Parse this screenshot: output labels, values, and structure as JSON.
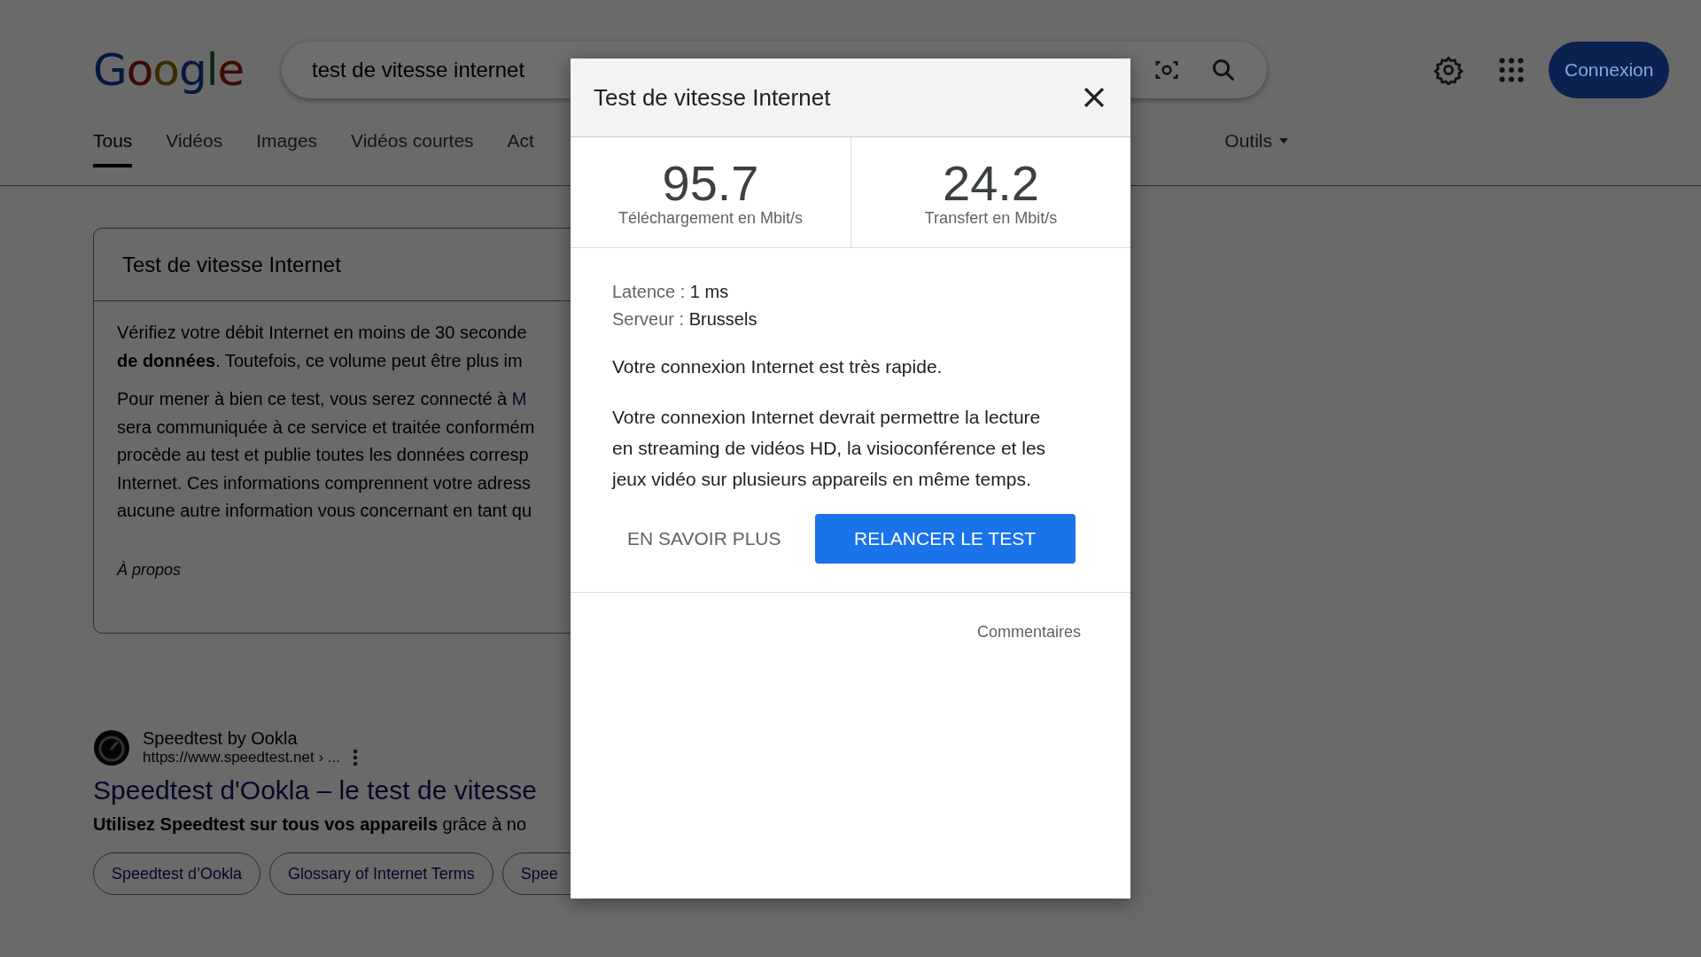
{
  "logo": "Google",
  "search": {
    "value": "test de vitesse internet"
  },
  "account_button": "Connexion",
  "tabs": [
    {
      "label": "Tous",
      "selected": true
    },
    {
      "label": "Vidéos",
      "selected": false
    },
    {
      "label": "Images",
      "selected": false
    },
    {
      "label": "Vidéos courtes",
      "selected": false
    },
    {
      "label": "Act",
      "selected": false
    }
  ],
  "tools": "Outils",
  "card": {
    "title": "Test de vitesse Internet",
    "paragraphs": [
      {
        "lines": [
          {
            "text": "Vérifiez votre débit Internet en moins de 30 seconde"
          },
          {
            "text": "**de données**. Toutefois, ce volume peut être plus im"
          }
        ]
      },
      {
        "lines": [
          {
            "text": "Pour mener à bien ce test, vous serez connecté à ",
            "link": "M"
          },
          {
            "text": "sera communiquée à ce service et traitée conformém"
          },
          {
            "text": "procède au test et publie toutes les données corresp"
          },
          {
            "text": "Internet. Ces informations comprennent votre adress"
          },
          {
            "text": "aucune autre information vous concernant en tant qu"
          }
        ]
      }
    ],
    "about": "À propos"
  },
  "result": {
    "site": "Speedtest by Ookla",
    "url": "https://www.speedtest.net › ...",
    "title": "Speedtest d'Ookla – le test de vitesse",
    "snippet": "**Utilisez Speedtest sur tous vos appareils** grâce à no",
    "chips": [
      "Speedtest d’Ookla",
      "Glossary of Internet Terms",
      "Spee"
    ]
  },
  "dialog": {
    "title": "Test de vitesse Internet",
    "stats": [
      {
        "value": "95.7",
        "label": "Téléchargement en Mbit/s"
      },
      {
        "value": "24.2",
        "label": "Transfert en Mbit/s"
      }
    ],
    "details": [
      {
        "label": "Latence :",
        "value": "1 ms"
      },
      {
        "label": "Serveur :",
        "value": "Brussels"
      }
    ],
    "messages": [
      "Votre connexion Internet est très rapide.",
      "Votre connexion Internet devrait permettre la lecture en streaming de vidéos HD, la visioconférence et les jeux vidéo sur plusieurs appareils en même temps."
    ],
    "buttons": [
      {
        "label": "EN SAVOIR PLUS",
        "kind": "text"
      },
      {
        "label": "RELANCER LE TEST",
        "kind": "primary"
      }
    ],
    "feedback": "Commentaires"
  }
}
